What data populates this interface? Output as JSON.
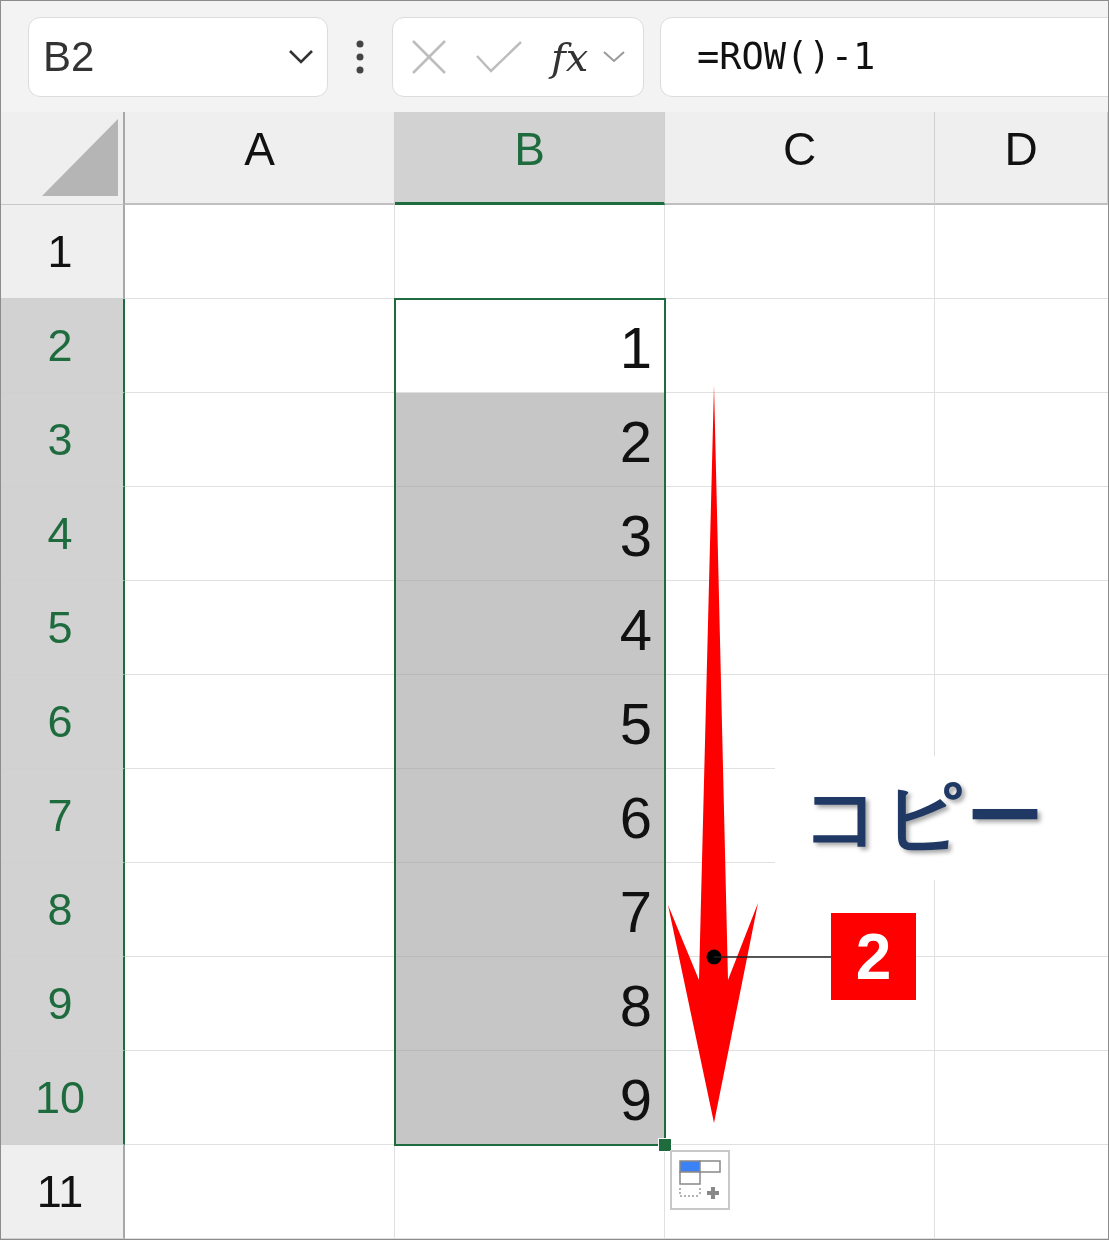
{
  "formula_bar": {
    "name_box": "B2",
    "function_label": "fx",
    "formula": "=ROW()-1"
  },
  "columns": [
    {
      "label": "A",
      "selected": false
    },
    {
      "label": "B",
      "selected": true
    },
    {
      "label": "C",
      "selected": false
    },
    {
      "label": "D",
      "selected": false
    }
  ],
  "rows": [
    {
      "label": "1",
      "selected": false,
      "cells": [
        null,
        null,
        null,
        null
      ]
    },
    {
      "label": "2",
      "selected": true,
      "cells": [
        null,
        {
          "value": "1",
          "selected": true,
          "active": true
        },
        null,
        null
      ]
    },
    {
      "label": "3",
      "selected": true,
      "cells": [
        null,
        {
          "value": "2",
          "selected": true,
          "active": false
        },
        null,
        null
      ]
    },
    {
      "label": "4",
      "selected": true,
      "cells": [
        null,
        {
          "value": "3",
          "selected": true,
          "active": false
        },
        null,
        null
      ]
    },
    {
      "label": "5",
      "selected": true,
      "cells": [
        null,
        {
          "value": "4",
          "selected": true,
          "active": false
        },
        null,
        null
      ]
    },
    {
      "label": "6",
      "selected": true,
      "cells": [
        null,
        {
          "value": "5",
          "selected": true,
          "active": false
        },
        null,
        null
      ]
    },
    {
      "label": "7",
      "selected": true,
      "cells": [
        null,
        {
          "value": "6",
          "selected": true,
          "active": false
        },
        null,
        null
      ]
    },
    {
      "label": "8",
      "selected": true,
      "cells": [
        null,
        {
          "value": "7",
          "selected": true,
          "active": false
        },
        null,
        null
      ]
    },
    {
      "label": "9",
      "selected": true,
      "cells": [
        null,
        {
          "value": "8",
          "selected": true,
          "active": false
        },
        null,
        null
      ]
    },
    {
      "label": "10",
      "selected": true,
      "cells": [
        null,
        {
          "value": "9",
          "selected": true,
          "active": false
        },
        null,
        null
      ]
    },
    {
      "label": "11",
      "selected": false,
      "cells": [
        null,
        null,
        null,
        null
      ]
    }
  ],
  "annotation": {
    "label": "コピー",
    "step": "2"
  }
}
